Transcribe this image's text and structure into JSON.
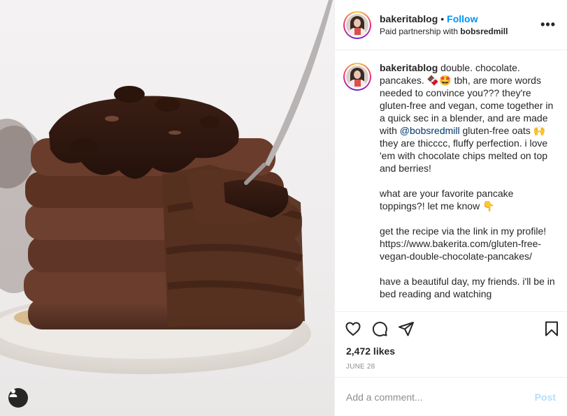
{
  "post": {
    "username": "bakeritablog",
    "follow_label": "Follow",
    "partnership_prefix": "Paid partnership with",
    "partner": "bobsredmill",
    "more_label": "•••"
  },
  "caption": {
    "username": "bakeritablog",
    "part1": " double. chocolate. pancakes. 🍫🤩 tbh, are more words needed to convince you??? they're gluten-free and vegan, come together in a quick sec in a blender, and are made with ",
    "mention": "@bobsredmill",
    "part2": " gluten-free oats 🙌 they are thicccc, fluffy perfection. i love 'em with chocolate chips melted on top and berries!",
    "paragraph2": "what are your favorite pancake toppings?! let me know 👇",
    "paragraph3": "get the recipe via the link in my profile!\nhttps://www.bakerita.com/gluten-free-vegan-double-chocolate-pancakes/",
    "paragraph4": "have a beautiful day, my friends. i'll be in bed reading and watching"
  },
  "engagement": {
    "likes": "2,472 likes",
    "date": "June 28"
  },
  "comment_input": {
    "placeholder": "Add a comment...",
    "post_label": "Post"
  },
  "icons": {
    "like": "heart-icon",
    "comment": "comment-icon",
    "share": "share-icon",
    "save": "bookmark-icon",
    "tagged": "user-tag-icon"
  },
  "colors": {
    "follow": "#0095f6",
    "post_disabled": "#b2dffc",
    "mention": "#00376b"
  }
}
